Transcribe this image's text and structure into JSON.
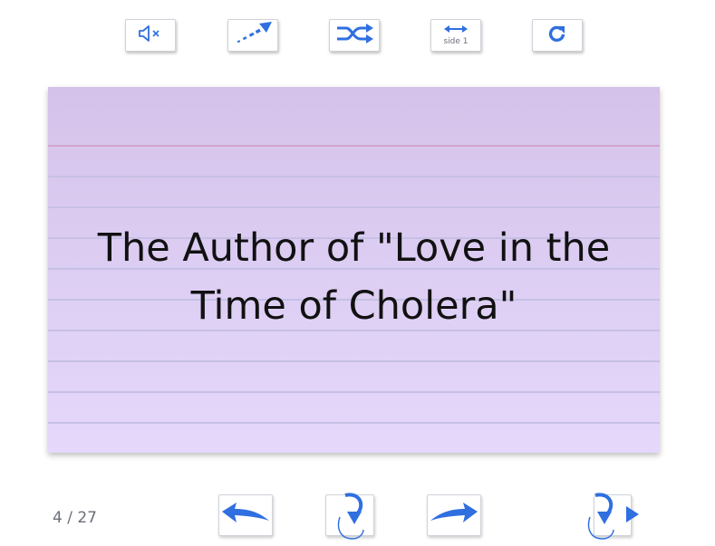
{
  "toolbar": {
    "mute_icon": "speaker-mute-icon",
    "speed_icon": "speed-arrow-icon",
    "shuffle_icon": "shuffle-icon",
    "side_icon": "side-swap-icon",
    "side_label": "side 1",
    "restart_icon": "restart-icon"
  },
  "card": {
    "text": "The Author of \"Love in the Time of Cholera\""
  },
  "footer": {
    "counter": "4 / 27",
    "prev_icon": "arrow-left-icon",
    "flip_icon": "flip-card-icon",
    "next_icon": "arrow-right-icon",
    "flip_auto_icon": "flip-and-next-icon"
  },
  "colors": {
    "accent": "#2f6fe0",
    "card_top": "#d5c2ea",
    "card_bottom": "#e5d8fb",
    "rule": "#c7c0e6",
    "margin_rule": "#d3a5c8"
  }
}
